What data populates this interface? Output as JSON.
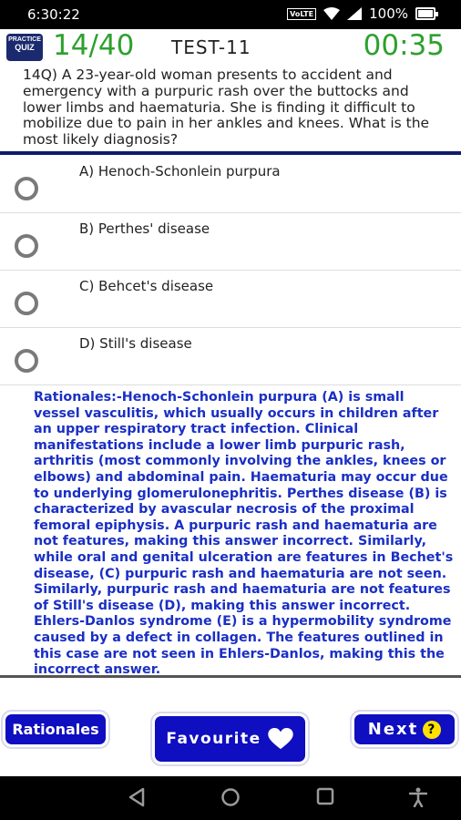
{
  "status": {
    "time": "6:30:22",
    "volte": "VoLTE",
    "battery": "100%",
    "battery_level": 1.0
  },
  "header": {
    "logo_top": "PRACTICE",
    "logo_main": "QUIZ",
    "question_counter": "14/40",
    "test_name": "TEST-11",
    "timer": "00:35"
  },
  "question": {
    "text": "14Q) A 23-year-old woman presents to accident and emergency with a purpuric rash over the buttocks and lower limbs and haematuria. She is finding it difficult to mobilize due to pain in her ankles and knees. What is the most likely diagnosis?"
  },
  "options": [
    {
      "label": "A) Henoch-Schonlein purpura"
    },
    {
      "label": "B) Perthes' disease"
    },
    {
      "label": "C) Behcet's disease"
    },
    {
      "label": "D) Still's disease"
    }
  ],
  "rationale": "Rationales:-Henoch-Schonlein purpura (A) is small vessel vasculitis, which usually occurs in children after an upper respiratory tract infection. Clinical manifestations include a lower limb purpuric rash, arthritis (most commonly involving the ankles, knees or elbows) and abdominal pain. Haematuria may occur due to underlying glomerulonephritis. Perthes disease (B) is characterized by avascular necrosis of the proximal femoral epiphysis. A purpuric rash and haematuria are not features, making this answer incorrect. Similarly, while oral and genital ulceration are features in Bechet's disease, (C) purpuric rash and haematuria are not seen. Similarly, purpuric rash and haematuria are not features of Still's disease (D), making this answer incorrect. Ehlers-Danlos syndrome (E) is a hypermobility syndrome caused by a defect in collagen. The features outlined in this case are not seen in Ehlers-Danlos, making this the incorrect answer.",
  "buttons": {
    "rationales": "Rationales",
    "favourite": "Favourite",
    "next": "Next",
    "next_badge": "?"
  },
  "colors": {
    "accent_green": "#2ea02e",
    "button_blue": "#0f0ec0",
    "rationale_blue": "#1a2fc4",
    "rule_navy": "#0e1c6a"
  },
  "icons": {
    "nav_back": "back-triangle-icon",
    "nav_home": "home-circle-icon",
    "nav_recent": "recents-square-icon",
    "nav_accessibility": "accessibility-icon"
  }
}
